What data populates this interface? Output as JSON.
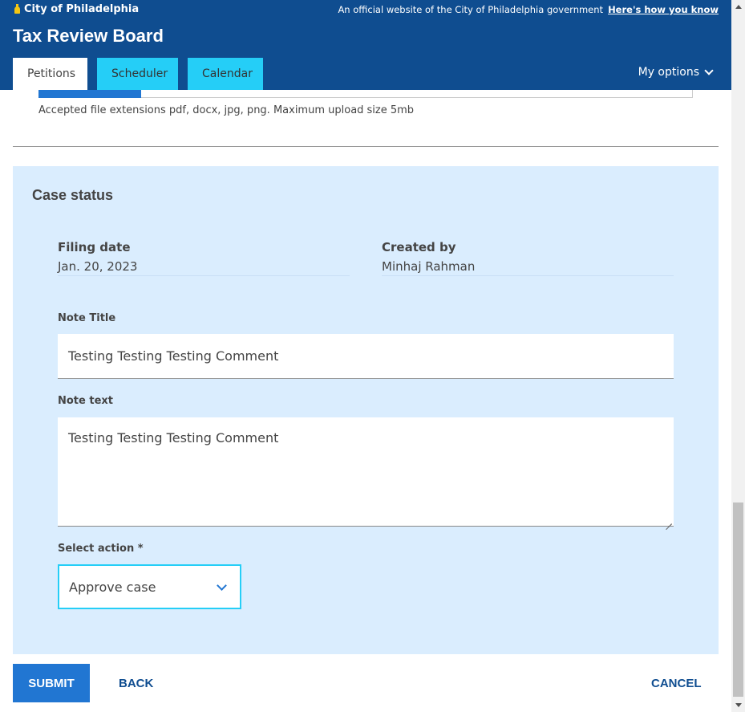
{
  "banner": {
    "city_name": "City of Philadelphia",
    "official_text": "An official website of the City of Philadelphia government",
    "how_link": "Here's how you know"
  },
  "header": {
    "title": "Tax Review Board",
    "tabs": [
      {
        "label": "Petitions",
        "active": true
      },
      {
        "label": "Scheduler",
        "active": false
      },
      {
        "label": "Calendar",
        "active": false
      }
    ],
    "options_label": "My options"
  },
  "upload": {
    "help_text": "Accepted file extensions pdf, docx, jpg, png. Maximum upload size 5mb"
  },
  "case_status": {
    "title": "Case status",
    "filing_date_label": "Filing date",
    "filing_date_value": "Jan. 20, 2023",
    "created_by_label": "Created by",
    "created_by_value": "Minhaj Rahman",
    "note_title_label": "Note Title",
    "note_title_value": "Testing Testing Testing Comment",
    "note_text_label": "Note text",
    "note_text_value": "Testing Testing Testing Comment",
    "action_label": "Select action *",
    "action_value": "Approve case"
  },
  "actions": {
    "submit": "SUBMIT",
    "back": "BACK",
    "cancel": "CANCEL"
  },
  "colors": {
    "brand_dark_blue": "#0f4d90",
    "tab_cyan": "#25cef7",
    "primary_blue": "#2176d2",
    "panel_bg": "#daedfe"
  }
}
